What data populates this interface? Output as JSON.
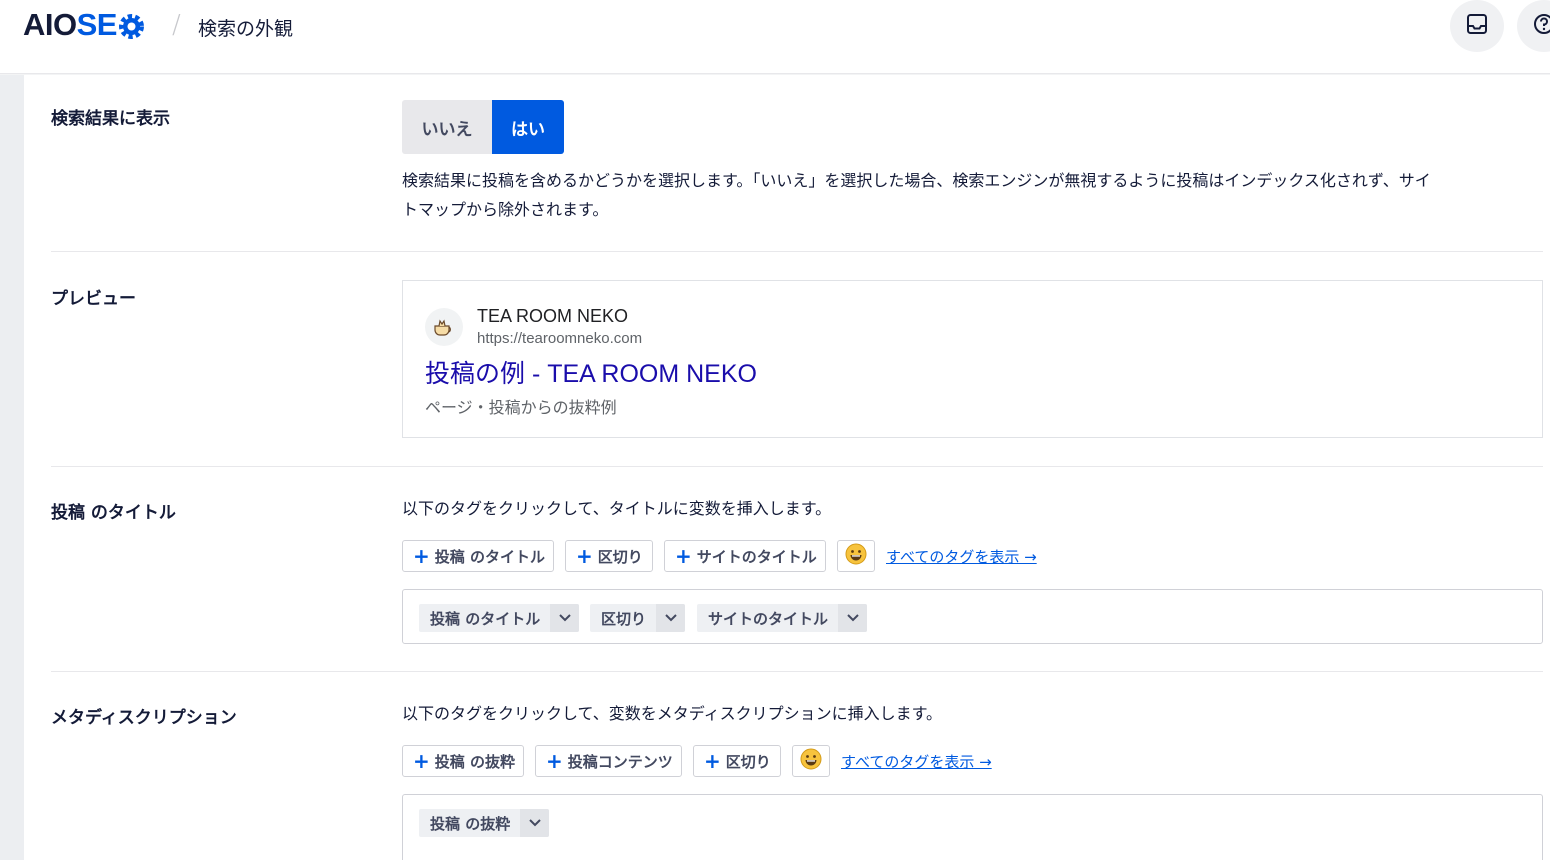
{
  "header": {
    "logo_part1": "AIO",
    "logo_part2": "SE",
    "breadcrumb_current": "検索の外観",
    "icons": [
      "gear-icon",
      "inbox-icon",
      "help-icon"
    ]
  },
  "colors": {
    "accent": "#005ae0",
    "text": "#141b38",
    "serp_title": "#1a0dab"
  },
  "show_in_results": {
    "label": "検索結果に表示",
    "option_no": "いいえ",
    "option_yes": "はい",
    "selected": "はい",
    "description_line1": "検索結果に投稿を含めるかどうかを選択します。「いいえ」を選択した場合、検索エンジンが無視するように投稿はインデックス化されず、サイ",
    "description_line2": "トマップから除外されます。"
  },
  "preview": {
    "label": "プレビュー",
    "site_name": "TEA ROOM NEKO",
    "site_url": "https://tearoomneko.com",
    "title": "投稿の例 - TEA ROOM NEKO",
    "description": "ページ・投稿からの抜粋例"
  },
  "post_title": {
    "label": "投稿 のタイトル",
    "help": "以下のタグをクリックして、タイトルに変数を挿入します。",
    "tags": [
      "投稿 のタイトル",
      "区切り",
      "サイトのタイトル"
    ],
    "view_all": "すべてのタグを表示 →",
    "chips": [
      "投稿 のタイトル",
      "区切り",
      "サイトのタイトル"
    ]
  },
  "meta_description": {
    "label": "メタディスクリプション",
    "help": "以下のタグをクリックして、変数をメタディスクリプションに挿入します。",
    "tags": [
      "投稿 の抜粋",
      "投稿コンテンツ",
      "区切り"
    ],
    "view_all": "すべてのタグを表示 →",
    "chips": [
      "投稿 の抜粋"
    ]
  }
}
